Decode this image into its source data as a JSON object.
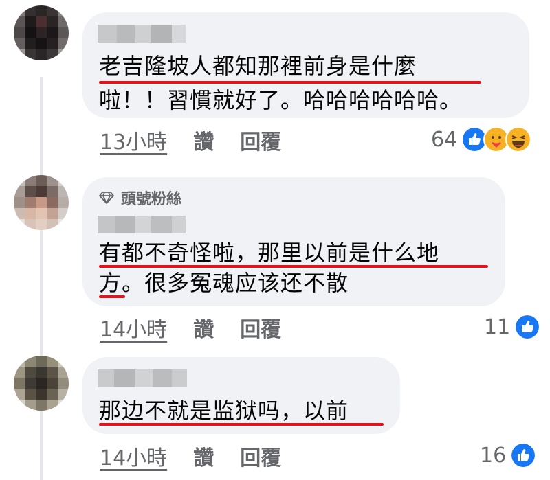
{
  "comments": [
    {
      "lines": [
        "老吉隆坡人都知那裡前身是什麼",
        "啦！！習慣就好了。哈哈哈哈哈哈。"
      ],
      "time": "13小時",
      "like": "讚",
      "reply": "回覆",
      "reaction_count": "64",
      "reactions": [
        "like-icon",
        "care-icon",
        "haha-icon"
      ]
    },
    {
      "badge": "頭號粉絲",
      "lines": [
        "有都不奇怪啦，那里以前是什么地",
        "方。很多冤魂应该还不散"
      ],
      "time": "14小時",
      "like": "讚",
      "reply": "回覆",
      "reaction_count": "11",
      "reactions": [
        "like-icon"
      ]
    },
    {
      "lines": [
        "那边不就是监狱吗，以前"
      ],
      "time": "14小時",
      "like": "讚",
      "reply": "回覆",
      "reaction_count": "16",
      "reactions": [
        "like-icon"
      ]
    }
  ],
  "colors": {
    "highlight": "#e0161c",
    "like": "#1877f2",
    "bubble": "#f0f2f5",
    "meta": "#65676b"
  }
}
